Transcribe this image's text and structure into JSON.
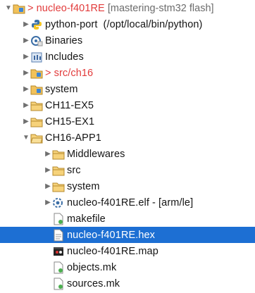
{
  "tree": {
    "project": {
      "prefix": ">",
      "name": "nucleo-f401RE",
      "branch": "[mastering-stm32 flash]"
    },
    "items": [
      {
        "label": "python-port",
        "detail": "(/opt/local/bin/python)"
      },
      {
        "label": "Binaries"
      },
      {
        "label": "Includes"
      },
      {
        "prefix": ">",
        "label": "src/ch16"
      },
      {
        "label": "system"
      },
      {
        "label": "CH11-EX5"
      },
      {
        "label": "CH15-EX1"
      },
      {
        "label": "CH16-APP1"
      },
      {
        "label": "Middlewares"
      },
      {
        "label": "src"
      },
      {
        "label": "system"
      },
      {
        "label": "nucleo-f401RE.elf",
        "detail": "- [arm/le]"
      },
      {
        "label": "makefile"
      },
      {
        "label": "nucleo-f401RE.hex"
      },
      {
        "label": "nucleo-f401RE.map"
      },
      {
        "label": "objects.mk"
      },
      {
        "label": "sources.mk"
      }
    ],
    "selected_item": "nucleo-f401RE.hex"
  },
  "colors": {
    "selection": "#1d6fd3",
    "red_label": "#e23b3b",
    "folder": "#f2c25a"
  },
  "icons": {
    "project": "project-folder-icon",
    "python": "python-icon",
    "binaries": "binaries-icon",
    "includes": "includes-icon",
    "folder": "folder-icon",
    "binary_file": "binary-file-icon",
    "text_file": "text-file-icon",
    "map_file": "map-file-icon"
  }
}
